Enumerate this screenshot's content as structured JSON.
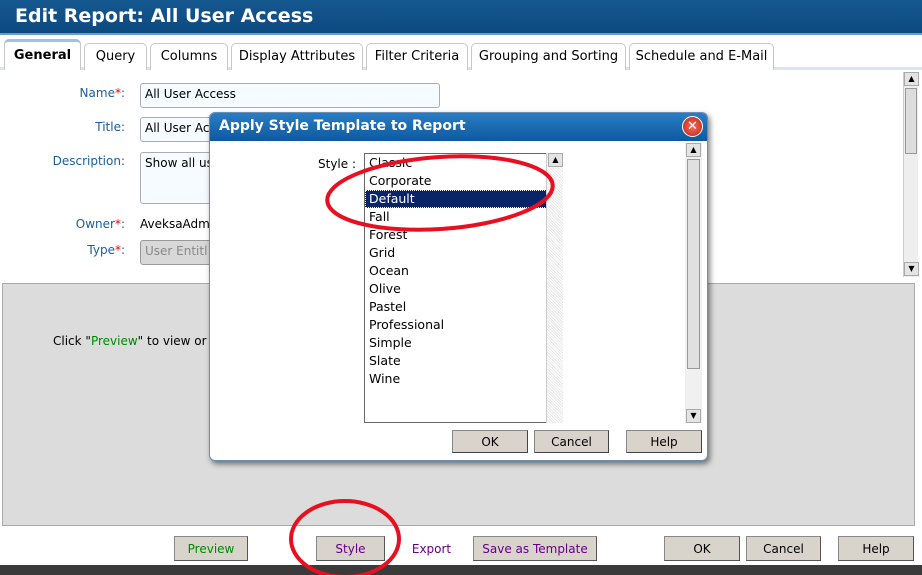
{
  "header": {
    "title": "Edit Report: All User Access"
  },
  "tabs": [
    {
      "label": "General",
      "active": true
    },
    {
      "label": "Query"
    },
    {
      "label": "Columns"
    },
    {
      "label": "Display Attributes"
    },
    {
      "label": "Filter Criteria"
    },
    {
      "label": "Grouping and Sorting"
    },
    {
      "label": "Schedule and E-Mail"
    }
  ],
  "form": {
    "name_label": "Name",
    "name_value": "All User Access",
    "title_label": "Title:",
    "title_value": "All User Ac",
    "description_label": "Description:",
    "description_value": "Show all us",
    "owner_label": "Owner",
    "owner_value": "AveksaAdm",
    "type_label": "Type",
    "type_value": "User Entitl",
    "required_mark": "*",
    "colon": ":"
  },
  "preview": {
    "before": "Click \"",
    "link": "Preview",
    "after": "\" to view or u"
  },
  "buttons": {
    "preview": "Preview",
    "style": "Style",
    "export": "Export",
    "save_template": "Save as Template",
    "ok": "OK",
    "cancel": "Cancel",
    "help": "Help"
  },
  "dialog": {
    "title": "Apply Style Template to Report",
    "style_label": "Style :",
    "options": [
      "Classic",
      "Corporate",
      "Default",
      "Fall",
      "Forest",
      "Grid",
      "Ocean",
      "Olive",
      "Pastel",
      "Professional",
      "Simple",
      "Slate",
      "Wine"
    ],
    "selected": "Default",
    "ok": "OK",
    "cancel": "Cancel",
    "help": "Help",
    "close_icon": "close-icon"
  },
  "colors": {
    "header": "#0c4a80",
    "annotation": "#e81020",
    "selection": "#0a246a"
  }
}
